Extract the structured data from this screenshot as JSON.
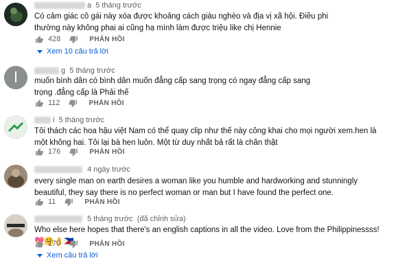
{
  "comments": [
    {
      "name_visible": "a",
      "time": "5 tháng trước",
      "edited": "",
      "text": "Có cảm giác cô gái này xóa được khoảng cách giàu nghèo và địa vị xã hội. Điều phi thường này không phai ai cũng hạ mình làm được triệu  like  chị Hennie",
      "likes": "428",
      "reply_label": "PHẢN HỒI",
      "view_replies": "Xem 10 câu trả lời",
      "avatar_color": "#1f2a22"
    },
    {
      "name_visible": "g",
      "time": "5 tháng trước",
      "edited": "",
      "text": "muốn bình dân có bình dân muốn đẳng cấp sang trọng có ngay đẳng cấp sang trọng .đẳng cấp là Phải thế",
      "likes": "112",
      "reply_label": "PHẢN HỒI",
      "view_replies": "",
      "avatar_color": "#8a8f8c"
    },
    {
      "name_visible": "i",
      "time": "5 tháng trước",
      "edited": "",
      "text": "Tôi thách các hoa hậu việt Nam có thể quay clip như thế này công khai cho mọi người xem.hen là một không hai. Tôi lại bà hen luôn. Một từ duy nhất bả rất là chân thật",
      "likes": "176",
      "reply_label": "PHẢN HỒI",
      "view_replies": "",
      "avatar_color": "#2a9a4a"
    },
    {
      "name_visible": "",
      "time": "4 ngày trước",
      "edited": "",
      "text": "every single man on earth desires a woman like you humble and hardworking and stunningly beautiful, they say there is no perfect woman or man but I have found the perfect one.",
      "likes": "11",
      "reply_label": "PHẢN HỒI",
      "view_replies": "",
      "avatar_color": "#6b5a4a"
    },
    {
      "name_visible": "",
      "time": "5 tháng trước",
      "edited": "(đã chỉnh sửa)",
      "text": "Who else here hopes that there's an english captions in all the video. Love from the Philippinessss! 💖🤗👌🇵🇭",
      "likes": "170",
      "reply_label": "PHẢN HỒI",
      "view_replies": "Xem câu trả lời",
      "avatar_color": "#c9c1b5"
    }
  ],
  "colors": {
    "link": "#065fd4",
    "meta": "#606060"
  }
}
